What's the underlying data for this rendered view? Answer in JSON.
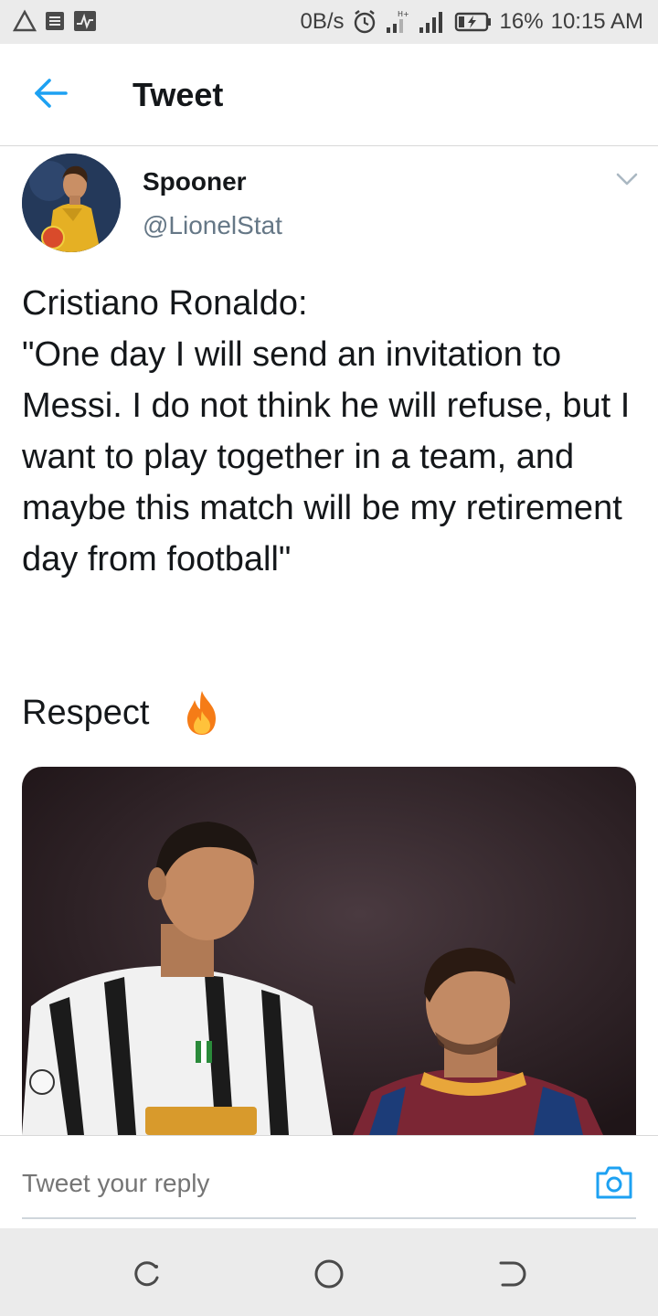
{
  "status_bar": {
    "net_speed": "0B/s",
    "battery": "16%",
    "time": "10:15 AM"
  },
  "header": {
    "title": "Tweet"
  },
  "tweet": {
    "author_name": "Spooner",
    "author_handle": "@LionelStat",
    "text": "Cristiano Ronaldo:\n\"One day I will send an invitation to Messi. I do not think he will refuse, but I want to play together in a team, and maybe this match will be my retirement day from football\"",
    "closing_text": "Respect"
  },
  "reply": {
    "placeholder": "Tweet your reply"
  },
  "colors": {
    "accent": "#1da1f2",
    "text_primary": "#14171a",
    "text_secondary": "#657786",
    "chrome": "#ebebeb"
  },
  "icons": {
    "back": "arrow-left-icon",
    "caret": "chevron-down-icon",
    "emoji": "fire-emoji-icon",
    "camera": "camera-icon",
    "nav": [
      "recent-apps-icon",
      "home-icon",
      "back-nav-icon"
    ]
  }
}
